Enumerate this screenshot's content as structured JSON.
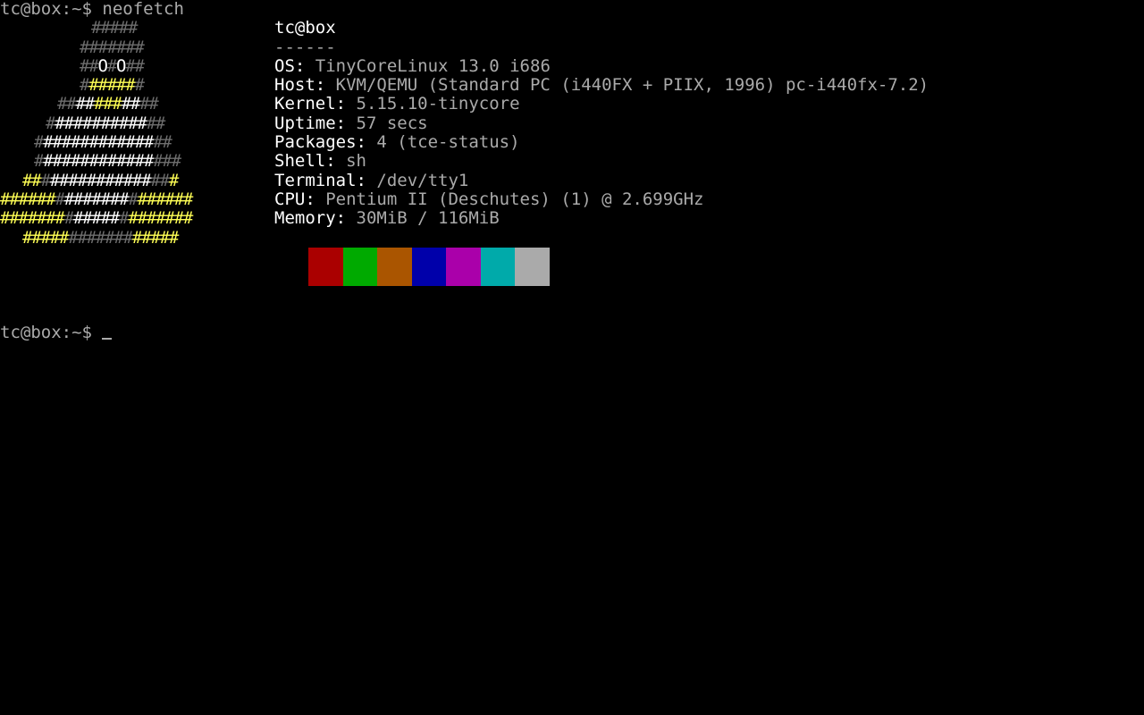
{
  "terminal": {
    "command_line": {
      "prompt": "tc@box:~$",
      "command": "neofetch"
    },
    "ascii_art": {
      "lines": [
        [
          {
            "t": "#####",
            "c": "g"
          }
        ],
        [
          {
            "t": "#######",
            "c": "g"
          }
        ],
        [
          {
            "t": "##",
            "c": "g"
          },
          {
            "t": "O",
            "c": "w"
          },
          {
            "t": "#",
            "c": "g"
          },
          {
            "t": "O",
            "c": "w"
          },
          {
            "t": "##",
            "c": "g"
          }
        ],
        [
          {
            "t": "#",
            "c": "g"
          },
          {
            "t": "#####",
            "c": "y"
          },
          {
            "t": "#",
            "c": "g"
          }
        ],
        [
          {
            "t": "##",
            "c": "g"
          },
          {
            "t": "##",
            "c": "w"
          },
          {
            "t": "###",
            "c": "y"
          },
          {
            "t": "##",
            "c": "w"
          },
          {
            "t": "##",
            "c": "g"
          }
        ],
        [
          {
            "t": "#",
            "c": "g"
          },
          {
            "t": "##########",
            "c": "w"
          },
          {
            "t": "##",
            "c": "g"
          }
        ],
        [
          {
            "t": "#",
            "c": "g"
          },
          {
            "t": "############",
            "c": "w"
          },
          {
            "t": "##",
            "c": "g"
          }
        ],
        [
          {
            "t": "#",
            "c": "g"
          },
          {
            "t": "############",
            "c": "w"
          },
          {
            "t": "###",
            "c": "g"
          }
        ],
        [
          {
            "t": "##",
            "c": "y"
          },
          {
            "t": "#",
            "c": "g"
          },
          {
            "t": "###########",
            "c": "w"
          },
          {
            "t": "##",
            "c": "g"
          },
          {
            "t": "#",
            "c": "y"
          }
        ],
        [
          {
            "t": "######",
            "c": "y"
          },
          {
            "t": "#",
            "c": "g"
          },
          {
            "t": "#######",
            "c": "w"
          },
          {
            "t": "#",
            "c": "g"
          },
          {
            "t": "######",
            "c": "y"
          }
        ],
        [
          {
            "t": "#######",
            "c": "y"
          },
          {
            "t": "#",
            "c": "g"
          },
          {
            "t": "#####",
            "c": "w"
          },
          {
            "t": "#",
            "c": "g"
          },
          {
            "t": "#######",
            "c": "y"
          }
        ],
        [
          {
            "t": "#####",
            "c": "y"
          },
          {
            "t": "#######",
            "c": "g"
          },
          {
            "t": "#####",
            "c": "y"
          }
        ]
      ]
    },
    "info": {
      "title": "tc@box",
      "separator": "------",
      "fields": [
        {
          "key": "OS",
          "value": "TinyCoreLinux 13.0 i686"
        },
        {
          "key": "Host",
          "value": "KVM/QEMU (Standard PC (i440FX + PIIX, 1996) pc-i440fx-7.2)"
        },
        {
          "key": "Kernel",
          "value": "5.15.10-tinycore"
        },
        {
          "key": "Uptime",
          "value": "57 secs"
        },
        {
          "key": "Packages",
          "value": "4 (tce-status)"
        },
        {
          "key": "Shell",
          "value": "sh"
        },
        {
          "key": "Terminal",
          "value": "/dev/tty1"
        },
        {
          "key": "CPU",
          "value": "Pentium II (Deschutes) (1) @ 2.699GHz"
        },
        {
          "key": "Memory",
          "value": "30MiB / 116MiB"
        }
      ]
    },
    "palette": [
      "#aa0000",
      "#00aa00",
      "#aa5500",
      "#0000aa",
      "#aa00aa",
      "#00aaaa",
      "#aaaaaa"
    ],
    "art_colors": {
      "g": "#6e6e6e",
      "w": "#ffffff",
      "y": "#ffff55"
    },
    "prompt_line": {
      "prompt": "tc@box:~$",
      "input": ""
    }
  }
}
